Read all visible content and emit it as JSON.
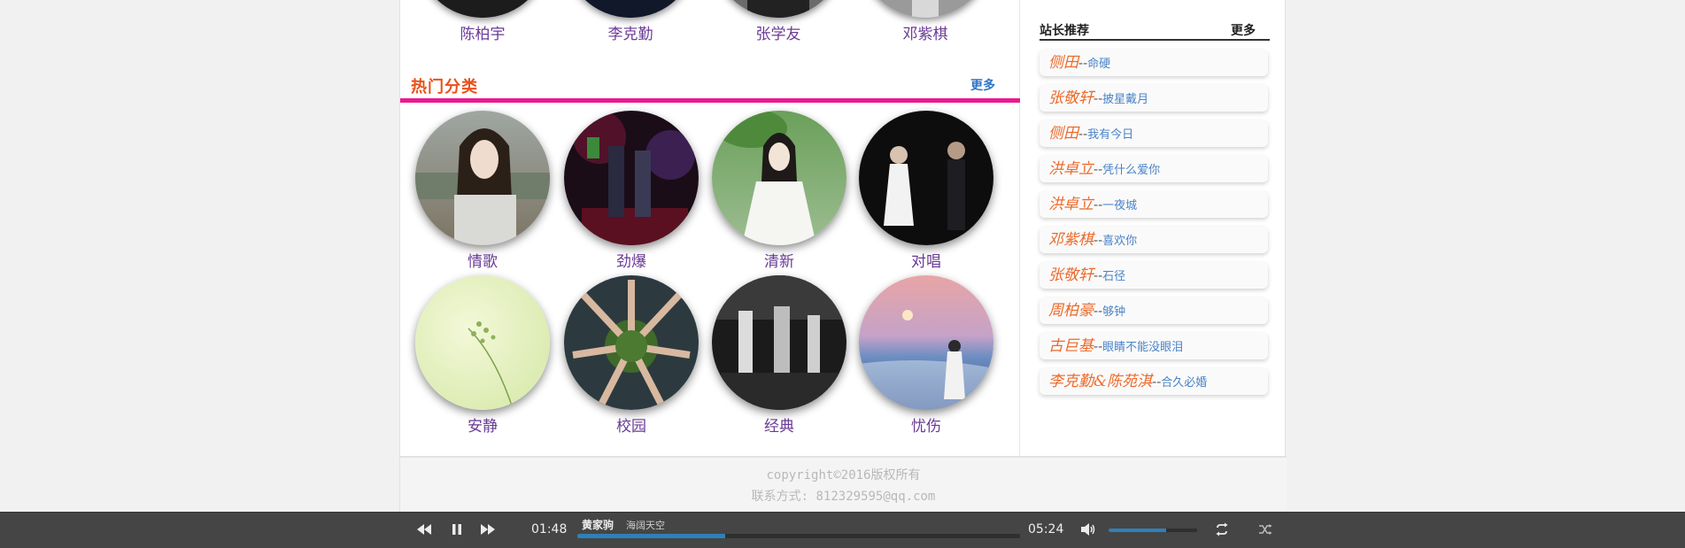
{
  "top_row": {
    "artists": [
      "陈柏宇",
      "李克勤",
      "张学友",
      "邓紫棋"
    ]
  },
  "hot_categories": {
    "title": "热门分类",
    "more": "更多",
    "items": [
      {
        "label": "情歌"
      },
      {
        "label": "劲爆"
      },
      {
        "label": "清新"
      },
      {
        "label": "对唱"
      },
      {
        "label": "安静"
      },
      {
        "label": "校园"
      },
      {
        "label": "经典"
      },
      {
        "label": "忧伤"
      }
    ]
  },
  "sidebar": {
    "title": "站长推荐",
    "more": "更多",
    "items": [
      {
        "artist": "侧田",
        "sep": "--",
        "song": "命硬"
      },
      {
        "artist": "张敬轩",
        "sep": "--",
        "song": "披星戴月"
      },
      {
        "artist": "侧田",
        "sep": "--",
        "song": "我有今日"
      },
      {
        "artist": "洪卓立",
        "sep": "--",
        "song": "凭什么爱你"
      },
      {
        "artist": "洪卓立",
        "sep": "--",
        "song": "一夜城"
      },
      {
        "artist": "邓紫棋",
        "sep": "--",
        "song": "喜欢你"
      },
      {
        "artist": "张敬轩",
        "sep": "--",
        "song": "石径"
      },
      {
        "artist": "周柏豪",
        "sep": "--",
        "song": "够钟"
      },
      {
        "artist": "古巨基",
        "sep": "--",
        "song": "眼睛不能没眼泪"
      },
      {
        "artist": "李克勤&陈苑淇",
        "sep": "--",
        "song": "合久必婚"
      }
    ]
  },
  "footer": {
    "copyright": "copyright©2016版权所有",
    "contact": "联系方式: 812329595@qq.com"
  },
  "player": {
    "current_time": "01:48",
    "total_time": "05:24",
    "singer": "黄家驹",
    "song": "海阔天空",
    "progress_fraction": 0.333,
    "volume_fraction": 0.65,
    "icons": [
      "prev-icon",
      "pause-icon",
      "next-icon",
      "volume-icon",
      "repeat-icon",
      "shuffle-icon"
    ]
  },
  "colors": {
    "accent_pink": "#ea1a8f",
    "title_orange": "#e9511a",
    "link_blue": "#2e76c7",
    "label_purple": "#6a3a96",
    "progress_blue": "#2f80b8"
  }
}
